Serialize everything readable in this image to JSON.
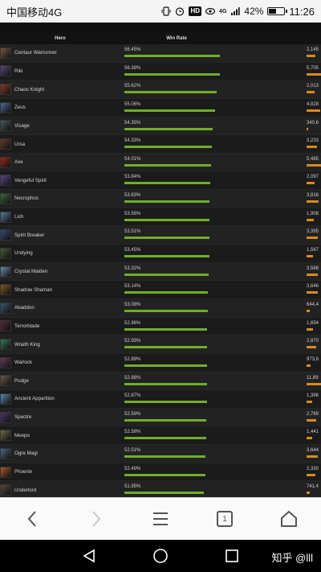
{
  "statusbar": {
    "carrier": "中国移动4G",
    "hd_badge": "HD",
    "signal_label": "4G",
    "battery_pct": "42%",
    "time": "11:26"
  },
  "table": {
    "headers": {
      "hero": "Hero",
      "win_rate": "Win Rate"
    },
    "rows": [
      {
        "hero": "Centaur Warrunner",
        "win_rate": "56.45%",
        "win_pct": 56.45,
        "games": "2,145",
        "games_frac": 0.55,
        "color": "#7a5a3a"
      },
      {
        "hero": "Riki",
        "win_rate": "56.38%",
        "win_pct": 56.38,
        "games": "5,705",
        "games_frac": 0.95,
        "color": "#5b4a7a"
      },
      {
        "hero": "Chaos Knight",
        "win_rate": "55.62%",
        "win_pct": 55.62,
        "games": "2,013",
        "games_frac": 0.5,
        "color": "#8a3a2a"
      },
      {
        "hero": "Zeus",
        "win_rate": "55.06%",
        "win_pct": 55.06,
        "games": "4,828",
        "games_frac": 0.85,
        "color": "#4a6a9a"
      },
      {
        "hero": "Visage",
        "win_rate": "54.35%",
        "win_pct": 54.35,
        "games": "340,6",
        "games_frac": 0.1,
        "color": "#4a5a5a"
      },
      {
        "hero": "Ursa",
        "win_rate": "54.33%",
        "win_pct": 54.33,
        "games": "3,233",
        "games_frac": 0.65,
        "color": "#6a3a2a"
      },
      {
        "hero": "Axe",
        "win_rate": "54.01%",
        "win_pct": 54.01,
        "games": "5,485",
        "games_frac": 0.95,
        "color": "#9a2a1a"
      },
      {
        "hero": "Vengeful Spirit",
        "win_rate": "53.84%",
        "win_pct": 53.84,
        "games": "2,097",
        "games_frac": 0.5,
        "color": "#5a4a8a"
      },
      {
        "hero": "Necrophos",
        "win_rate": "53.63%",
        "win_pct": 53.63,
        "games": "3,816",
        "games_frac": 0.75,
        "color": "#3a6a3a"
      },
      {
        "hero": "Lich",
        "win_rate": "53.56%",
        "win_pct": 53.56,
        "games": "1,908",
        "games_frac": 0.45,
        "color": "#5a7a9a"
      },
      {
        "hero": "Spirit Breaker",
        "win_rate": "53.51%",
        "win_pct": 53.51,
        "games": "3,395",
        "games_frac": 0.7,
        "color": "#3a4a7a"
      },
      {
        "hero": "Undying",
        "win_rate": "53.45%",
        "win_pct": 53.45,
        "games": "1,567",
        "games_frac": 0.4,
        "color": "#4a5a3a"
      },
      {
        "hero": "Crystal Maiden",
        "win_rate": "53.32%",
        "win_pct": 53.32,
        "games": "3,588",
        "games_frac": 0.72,
        "color": "#6a8aaa"
      },
      {
        "hero": "Shadow Shaman",
        "win_rate": "53.14%",
        "win_pct": 53.14,
        "games": "3,646",
        "games_frac": 0.72,
        "color": "#7a5a2a"
      },
      {
        "hero": "Abaddon",
        "win_rate": "53.08%",
        "win_pct": 53.08,
        "games": "644,4",
        "games_frac": 0.18,
        "color": "#3a5a6a"
      },
      {
        "hero": "Terrorblade",
        "win_rate": "52.96%",
        "win_pct": 52.96,
        "games": "1,654",
        "games_frac": 0.4,
        "color": "#5a2a3a"
      },
      {
        "hero": "Wraith King",
        "win_rate": "52.93%",
        "win_pct": 52.93,
        "games": "2,870",
        "games_frac": 0.6,
        "color": "#3a7a5a"
      },
      {
        "hero": "Warlock",
        "win_rate": "52.89%",
        "win_pct": 52.89,
        "games": "973,6",
        "games_frac": 0.25,
        "color": "#6a3a5a"
      },
      {
        "hero": "Pudge",
        "win_rate": "52.88%",
        "win_pct": 52.88,
        "games": "11,89",
        "games_frac": 1.0,
        "color": "#6a5a4a"
      },
      {
        "hero": "Ancient Apparition",
        "win_rate": "52.87%",
        "win_pct": 52.87,
        "games": "1,396",
        "games_frac": 0.35,
        "color": "#5a8aaa"
      },
      {
        "hero": "Spectre",
        "win_rate": "52.59%",
        "win_pct": 52.59,
        "games": "2,769",
        "games_frac": 0.6,
        "color": "#4a3a6a"
      },
      {
        "hero": "Meepo",
        "win_rate": "52.58%",
        "win_pct": 52.58,
        "games": "1,441",
        "games_frac": 0.35,
        "color": "#6a6a4a"
      },
      {
        "hero": "Ogre Magi",
        "win_rate": "52.51%",
        "win_pct": 52.51,
        "games": "3,644",
        "games_frac": 0.72,
        "color": "#4a6a8a"
      },
      {
        "hero": "Phoenix",
        "win_rate": "52.49%",
        "win_pct": 52.49,
        "games": "2,330",
        "games_frac": 0.55,
        "color": "#aa5a2a"
      },
      {
        "hero": "Underlord",
        "win_rate": "51.95%",
        "win_pct": 51.95,
        "games": "741,4",
        "games_frac": 0.2,
        "color": "#5a4a3a"
      }
    ]
  },
  "browser": {
    "back_icon": "chevron-left-icon",
    "forward_icon": "chevron-right-icon",
    "menu_icon": "hamburger-icon",
    "tab_count": "1",
    "home_icon": "home-icon"
  },
  "navbar": {
    "watermark": "知乎 @lll"
  }
}
